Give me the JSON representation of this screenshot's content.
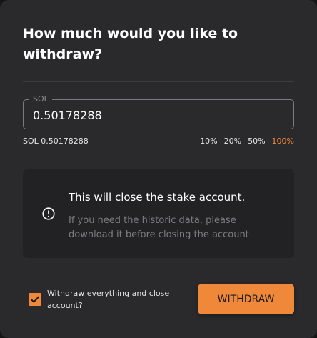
{
  "modal": {
    "title": "How much would you like to withdraw?"
  },
  "amount": {
    "legend": "SOL",
    "value": "0.50178288"
  },
  "balance": {
    "text": "SOL 0.50178288"
  },
  "percent_options": [
    {
      "label": "10%",
      "active": false
    },
    {
      "label": "20%",
      "active": false
    },
    {
      "label": "50%",
      "active": false
    },
    {
      "label": "100%",
      "active": true
    }
  ],
  "notice": {
    "icon": "alert-circle-icon",
    "heading": "This will close the stake account.",
    "body": "If you need the historic data, please download it before closing the account"
  },
  "close_account": {
    "checked": true,
    "label": "Withdraw everything and close account?"
  },
  "withdraw_button": {
    "label": "WITHDRAW"
  },
  "colors": {
    "accent": "#f0883a",
    "modal_background": "#2a2a2c",
    "notice_background": "#222224"
  }
}
